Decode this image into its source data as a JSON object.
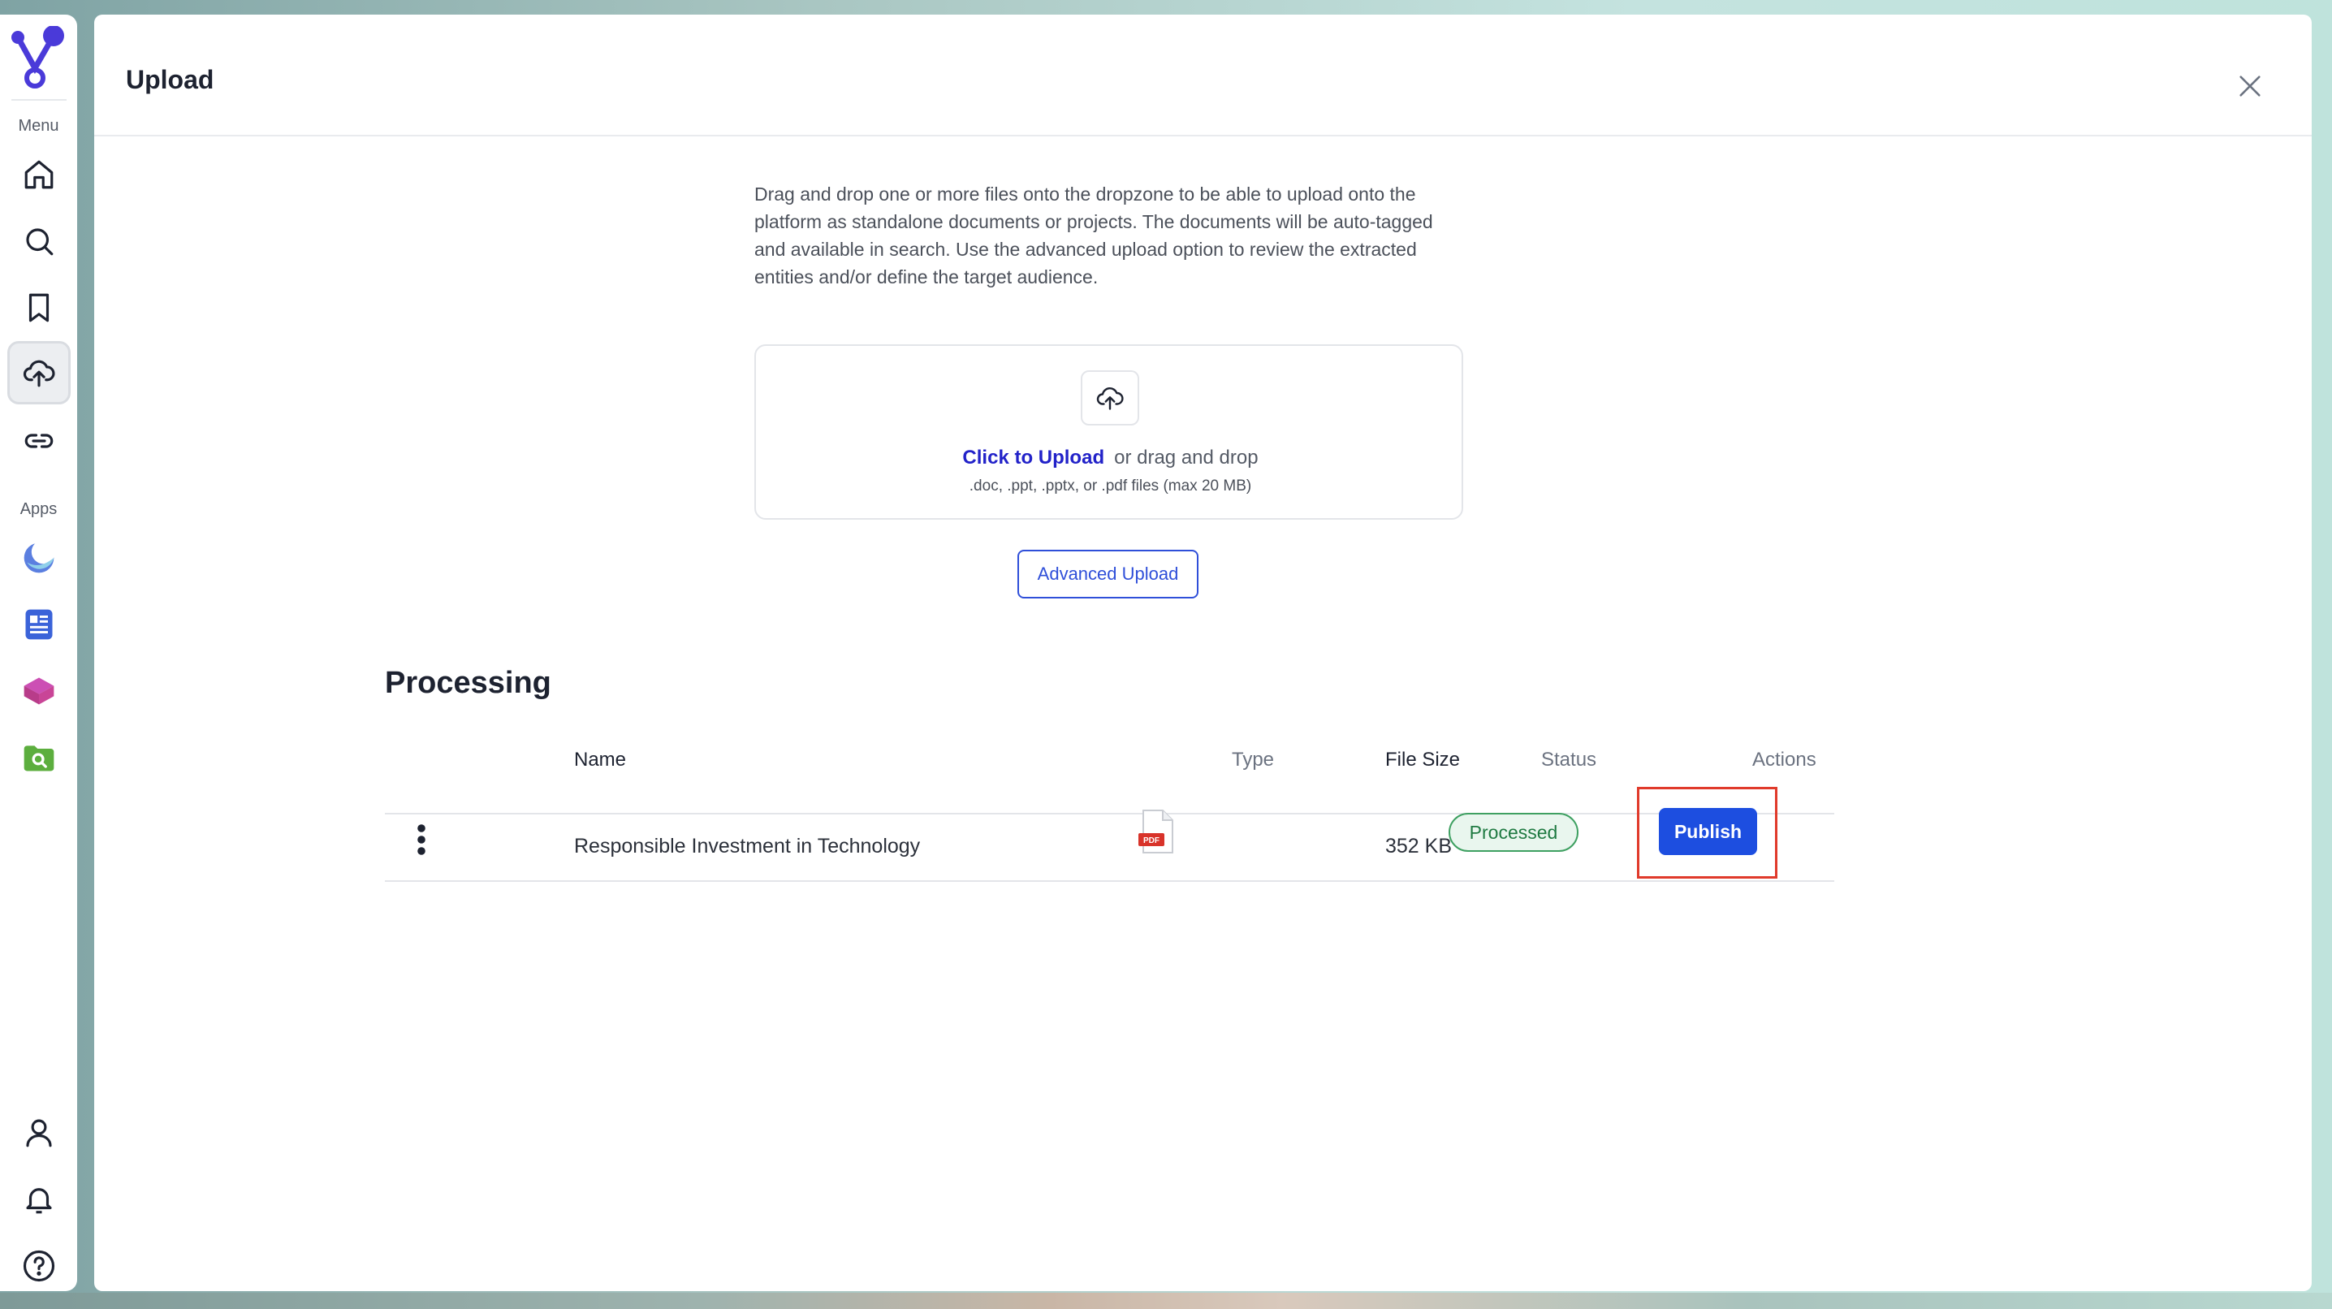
{
  "sidebar": {
    "menu_label": "Menu",
    "apps_label": "Apps",
    "nav_items": [
      {
        "icon": "home-icon"
      },
      {
        "icon": "search-icon"
      },
      {
        "icon": "bookmark-icon"
      },
      {
        "icon": "upload-cloud-icon",
        "active": true
      },
      {
        "icon": "link-icon"
      }
    ],
    "apps": [
      {
        "icon": "moon-app-icon"
      },
      {
        "icon": "document-app-icon"
      },
      {
        "icon": "cube-app-icon"
      },
      {
        "icon": "folder-search-app-icon"
      }
    ],
    "bottom_items": [
      {
        "icon": "user-icon"
      },
      {
        "icon": "bell-icon"
      },
      {
        "icon": "help-icon"
      }
    ]
  },
  "panel": {
    "title": "Upload",
    "description": "Drag and drop one or more files onto the dropzone to be able to upload onto the platform as standalone documents or projects. The documents will be auto-tagged and available in search. Use the advanced upload option to review the extracted entities and/or define the target audience.",
    "dropzone": {
      "link_text": "Click to Upload",
      "text": "or drag and drop",
      "hint": ".doc, .ppt, .pptx, or .pdf files (max 20 MB)"
    },
    "advanced_upload_label": "Advanced Upload"
  },
  "processing": {
    "title": "Processing",
    "columns": {
      "name": "Name",
      "type": "Type",
      "file_size": "File Size",
      "status": "Status",
      "actions": "Actions"
    },
    "rows": [
      {
        "name": "Responsible Investment in Technology",
        "type_icon": "pdf-file-icon",
        "type_label": "PDF",
        "file_size": "352 KB",
        "status": "Processed",
        "action_label": "Publish"
      }
    ]
  },
  "colors": {
    "accent": "#1d4ee0",
    "link": "#2222c9",
    "status_green": "#3ea061",
    "highlight_red": "#e03a2b"
  }
}
